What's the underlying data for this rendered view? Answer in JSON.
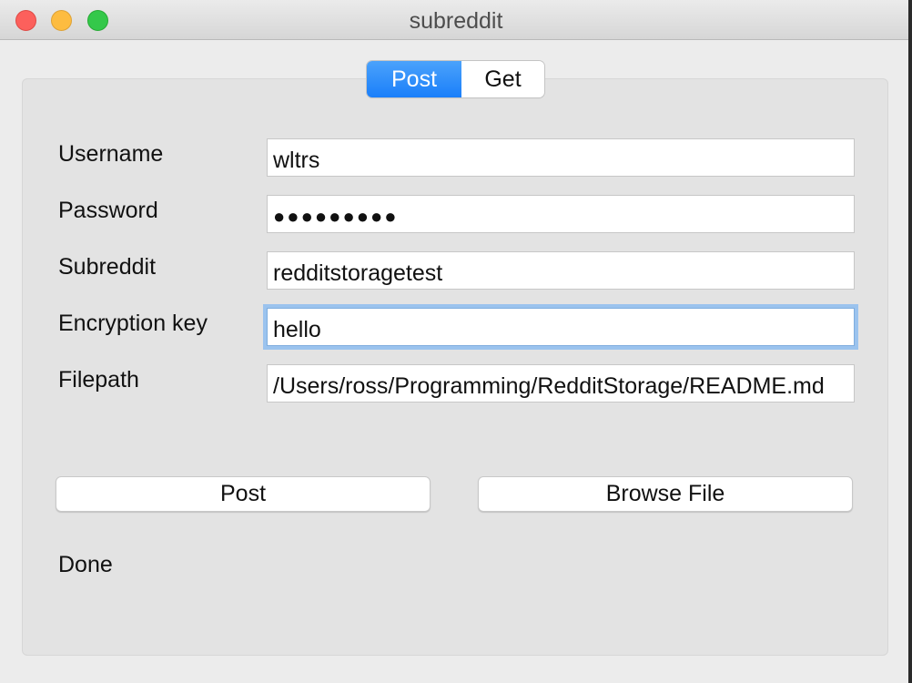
{
  "window": {
    "title": "subreddit"
  },
  "tabs": [
    {
      "label": "Post",
      "selected": true
    },
    {
      "label": "Get",
      "selected": false
    }
  ],
  "form": {
    "username": {
      "label": "Username",
      "value": "wltrs"
    },
    "password": {
      "label": "Password",
      "value": "●●●●●●●●●"
    },
    "subreddit": {
      "label": "Subreddit",
      "value": "redditstoragetest"
    },
    "encryption_key": {
      "label": "Encryption key",
      "value": "hello"
    },
    "filepath": {
      "label": "Filepath",
      "value": "/Users/ross/Programming/RedditStorage/README.md"
    }
  },
  "buttons": {
    "post": "Post",
    "browse": "Browse File"
  },
  "status": "Done",
  "colors": {
    "accent": "#1a7ffa",
    "focus_ring": "#9bc3ee"
  }
}
